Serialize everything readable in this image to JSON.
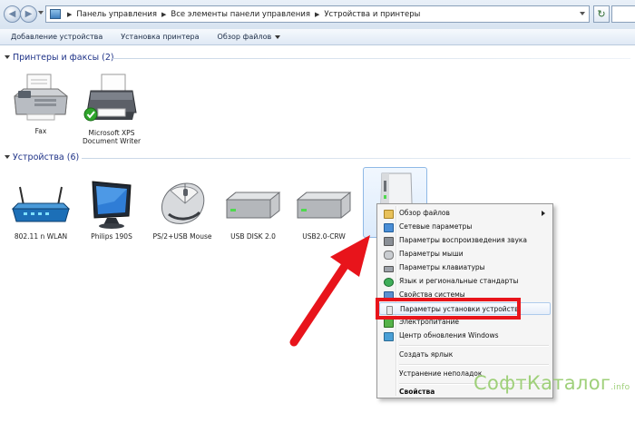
{
  "address_bar": {
    "breadcrumbs": [
      "Панель управления",
      "Все элементы панели управления",
      "Устройства и принтеры"
    ]
  },
  "command_bar": {
    "add_device": "Добавление устройства",
    "add_printer": "Установка принтера",
    "browse_files": "Обзор файлов"
  },
  "groups": {
    "printers": {
      "title": "Принтеры и факсы (2)",
      "items": [
        {
          "label": "Fax",
          "icon": "fax-icon"
        },
        {
          "label": "Microsoft XPS Document Writer",
          "icon": "printer-icon"
        }
      ]
    },
    "devices": {
      "title": "Устройства (6)",
      "items": [
        {
          "label": "802.11 n WLAN",
          "icon": "router-icon"
        },
        {
          "label": "Philips 190S",
          "icon": "monitor-icon"
        },
        {
          "label": "PS/2+USB Mouse",
          "icon": "mouse-icon"
        },
        {
          "label": "USB DISK 2.0",
          "icon": "drive-icon"
        },
        {
          "label": "USB2.0-CRW",
          "icon": "drive-icon"
        },
        {
          "label": "",
          "icon": "computer-icon"
        }
      ]
    }
  },
  "context_menu": {
    "items": [
      {
        "label": "Обзор файлов",
        "icon": "folder-icon",
        "submenu": true
      },
      {
        "label": "Сетевые параметры",
        "icon": "network-icon"
      },
      {
        "label": "Параметры воспроизведения звука",
        "icon": "speaker-icon"
      },
      {
        "label": "Параметры мыши",
        "icon": "mouse-icon"
      },
      {
        "label": "Параметры клавиатуры",
        "icon": "keyboard-icon"
      },
      {
        "label": "Язык и региональные стандарты",
        "icon": "globe-icon"
      },
      {
        "label": "Свойства системы",
        "icon": "system-icon"
      },
      {
        "label": "Параметры установки устройств",
        "icon": "device-install-icon",
        "highlighted": true
      },
      {
        "label": "Электропитание",
        "icon": "power-icon"
      },
      {
        "label": "Центр обновления Windows",
        "icon": "windows-update-icon"
      },
      {
        "label": "Создать ярлык"
      },
      {
        "label": "Устранение неполадок"
      },
      {
        "label": "Свойства",
        "bold": true
      }
    ]
  },
  "watermark": {
    "text": "СофтКаталог",
    "suffix": ".info"
  },
  "colors": {
    "highlight_box": "#e8141b",
    "arrow": "#e8141b",
    "group_title": "#1e3287",
    "watermark": "#9fd07a"
  }
}
